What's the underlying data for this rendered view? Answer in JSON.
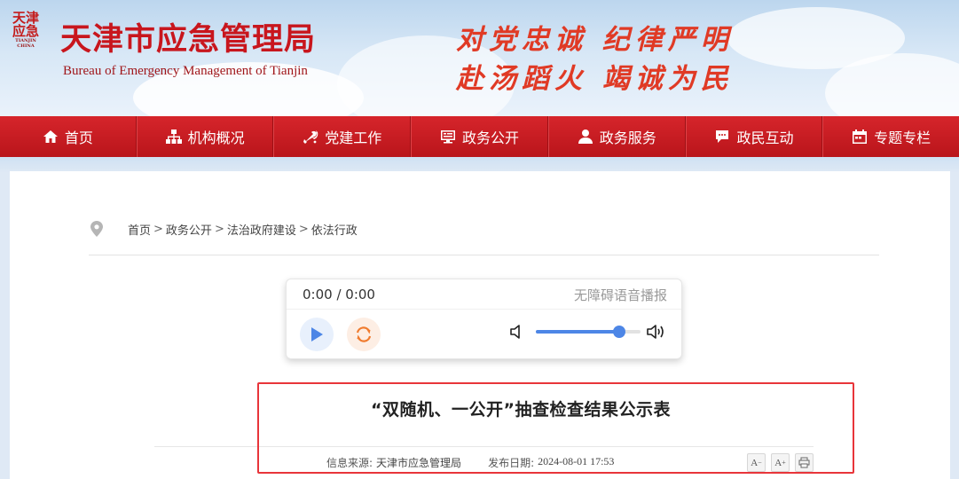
{
  "header": {
    "seal_text": [
      "天津",
      "应急"
    ],
    "seal_sub": "TIANJIN CHINA",
    "site_title": "天津市应急管理局",
    "site_subtitle": "Bureau of Emergency Management of Tianjin",
    "slogan_line1": "对党忠诚 纪律严明",
    "slogan_line2": "赴汤蹈火 竭诚为民"
  },
  "nav": {
    "items": [
      {
        "label": "首页",
        "icon": "home-icon"
      },
      {
        "label": "机构概况",
        "icon": "org-chart-icon"
      },
      {
        "label": "党建工作",
        "icon": "party-emblem-icon"
      },
      {
        "label": "政务公开",
        "icon": "monitor-icon"
      },
      {
        "label": "政务服务",
        "icon": "person-service-icon"
      },
      {
        "label": "政民互动",
        "icon": "chat-icon"
      },
      {
        "label": "专题专栏",
        "icon": "calendar-icon"
      }
    ]
  },
  "breadcrumb": {
    "items": [
      "首页",
      "政务公开",
      "法治政府建设",
      "依法行政"
    ],
    "separator": ">"
  },
  "player": {
    "time": "0:00 / 0:00",
    "label": "无障碍语音播报",
    "volume": 0.8,
    "accent_color": "#4d86e6"
  },
  "article": {
    "title": "“双随机、一公开”抽查检查结果公示表",
    "source_label": "信息来源:",
    "source": "天津市应急管理局",
    "date_label": "发布日期:",
    "date": "2024-08-01 17:53",
    "tools": {
      "font_smaller": "A",
      "font_larger": "A"
    }
  },
  "colors": {
    "brand_red": "#c8161d",
    "nav_red": "#c8181e",
    "highlight": "#e8353a"
  }
}
